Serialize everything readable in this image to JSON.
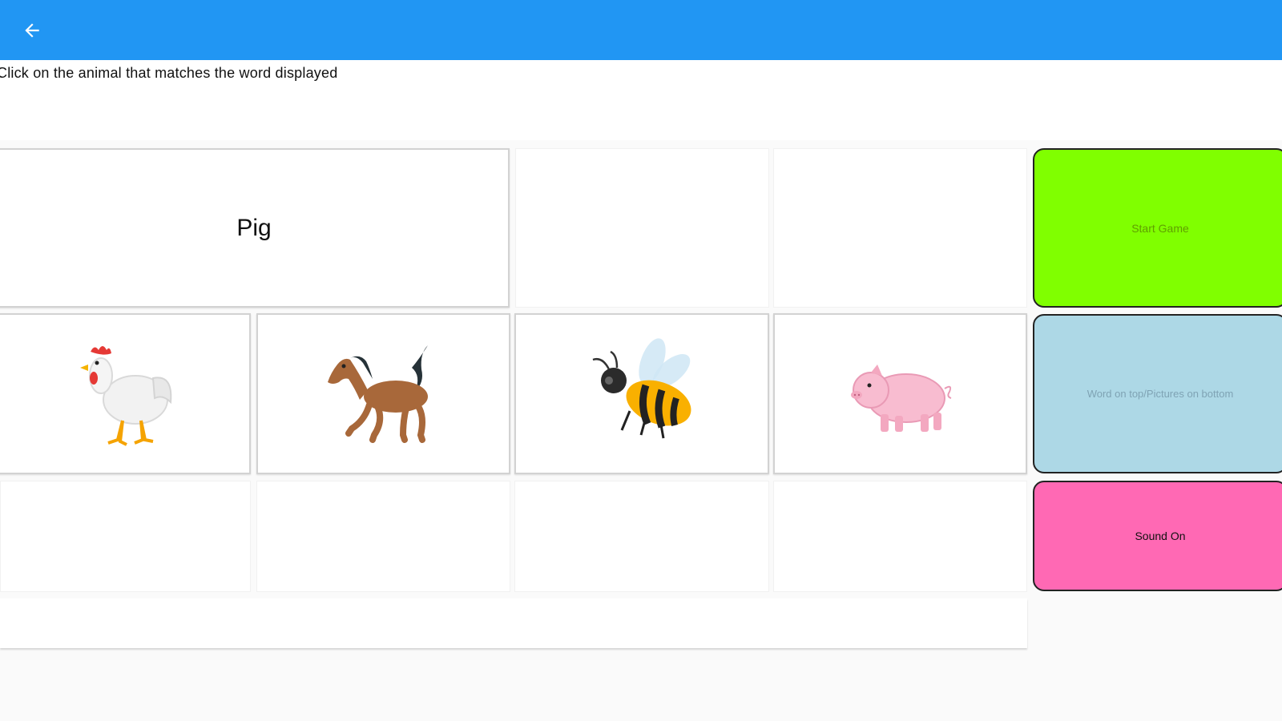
{
  "header": {
    "back_icon": "arrow-left-icon",
    "color": "#2196f3"
  },
  "instruction": "Click on the animal that matches the word displayed",
  "word": "Pig",
  "animals": [
    {
      "name": "rooster",
      "icon": "rooster-icon"
    },
    {
      "name": "horse",
      "icon": "horse-icon"
    },
    {
      "name": "bee",
      "icon": "bee-icon"
    },
    {
      "name": "pig",
      "icon": "pig-icon"
    }
  ],
  "buttons": {
    "start_game": {
      "label": "Start Game",
      "color": "#80ff00"
    },
    "layout_mode": {
      "label": "Word on top/Pictures on bottom",
      "color": "#add8e6"
    },
    "sound": {
      "label": "Sound On",
      "color": "#ff69b4"
    }
  }
}
